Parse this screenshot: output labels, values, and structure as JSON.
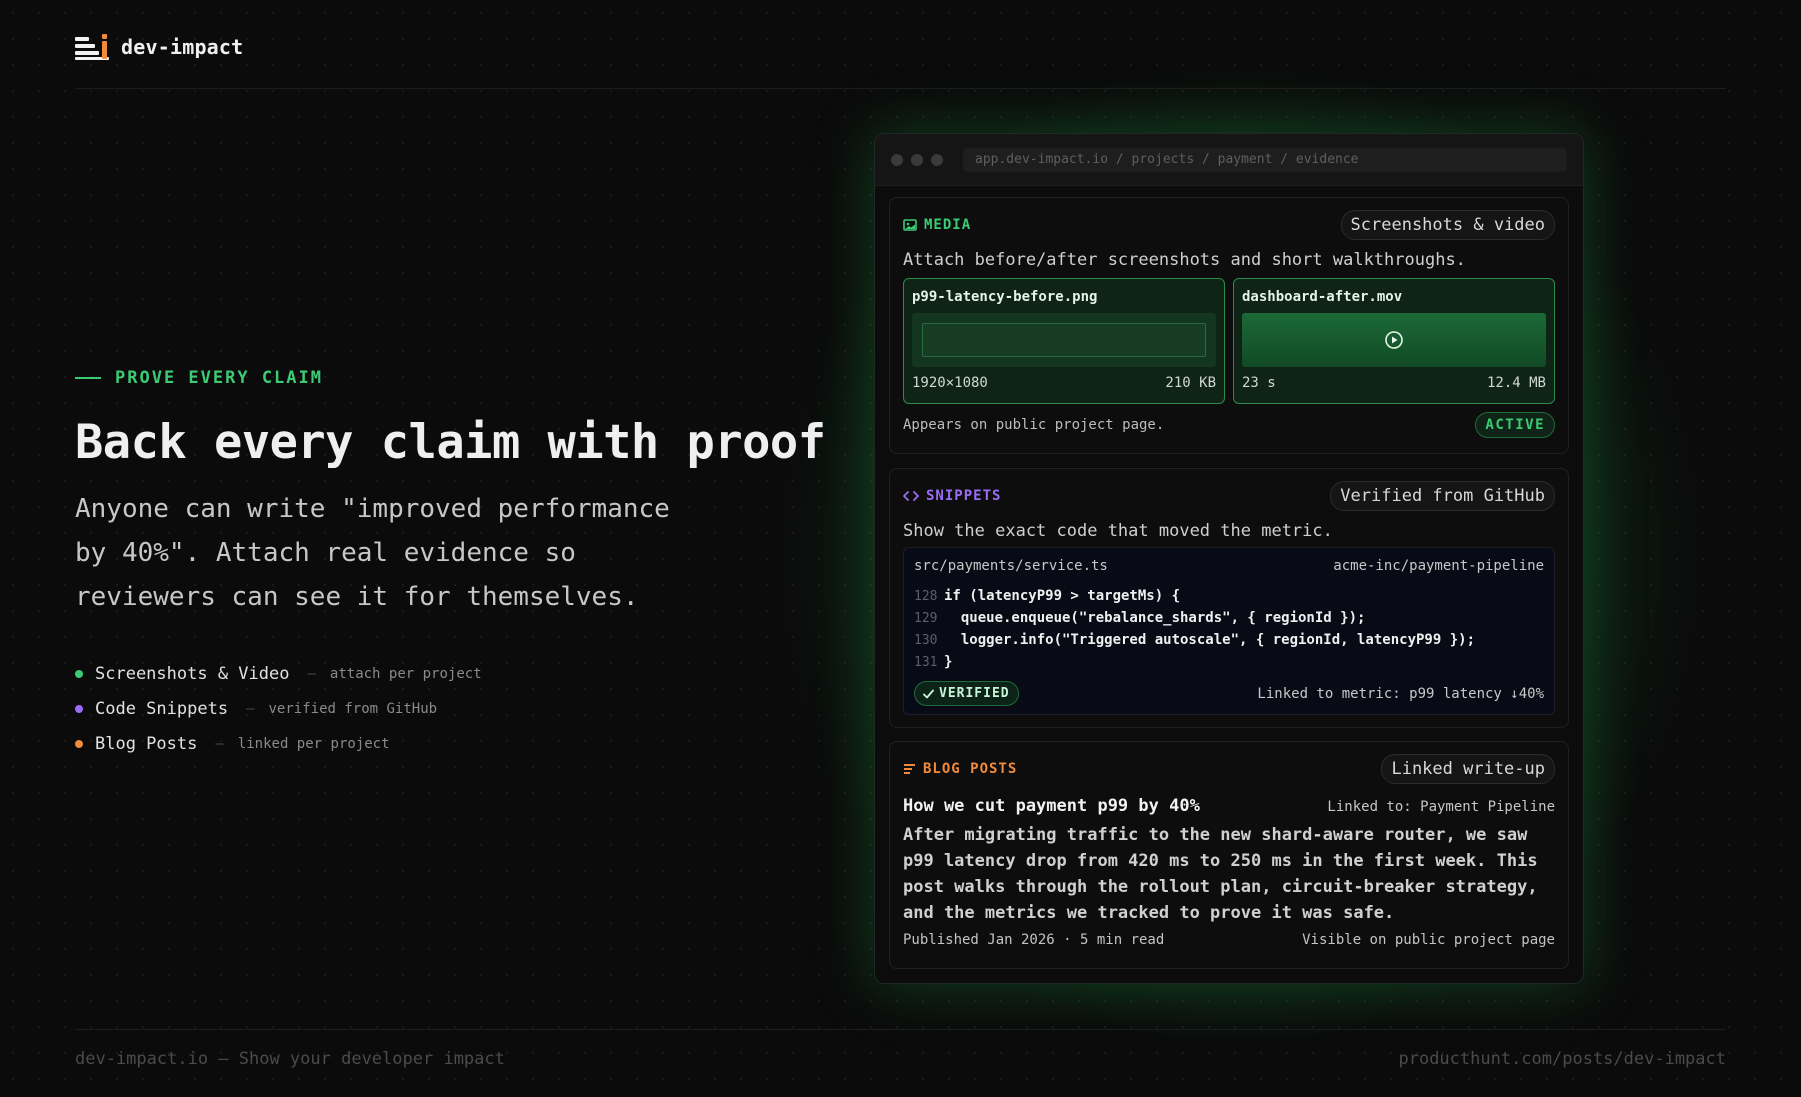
{
  "header": {
    "brand": "dev-impact",
    "logo_icon": "dev-impact-logo"
  },
  "hero": {
    "eyebrow": "PROVE EVERY CLAIM",
    "title": "Back every claim with proof",
    "subtitle": "Anyone can write \"improved performance by 40%\". Attach real evidence so reviewers can see it for themselves.",
    "features": [
      {
        "name": "Screenshots & Video",
        "desc": "attach per project",
        "color": "#3ccb74"
      },
      {
        "name": "Code Snippets",
        "desc": "verified from GitHub",
        "color": "#9b6cf5"
      },
      {
        "name": "Blog Posts",
        "desc": "linked per project",
        "color": "#f08a3c"
      }
    ],
    "separator": "—"
  },
  "window": {
    "url": "app.dev-impact.io / projects / payment / evidence",
    "media": {
      "tag": "MEDIA",
      "tag_color": "#3ccb74",
      "pill": "Screenshots & video",
      "text": "Attach before/after screenshots and short walkthroughs.",
      "tiles": [
        {
          "filename": "p99-latency-before.png",
          "dims": "1920×1080",
          "size": "210 KB",
          "kind": "image"
        },
        {
          "filename": "dashboard-after.mov",
          "dims": "23 s",
          "size": "12.4 MB",
          "kind": "video"
        }
      ],
      "note": "Appears on public project page.",
      "status": "ACTIVE"
    },
    "snippets": {
      "tag": "SNIPPETS",
      "tag_color": "#9b6cf5",
      "pill": "Verified from GitHub",
      "text": "Show the exact code that moved the metric.",
      "file": "src/payments/service.ts",
      "repo": "acme-inc/payment-pipeline",
      "lines": [
        {
          "n": "128",
          "code": "if (latencyP99 > targetMs) {"
        },
        {
          "n": "129",
          "code": "  queue.enqueue(\"rebalance_shards\", { regionId });"
        },
        {
          "n": "130",
          "code": "  logger.info(\"Triggered autoscale\", { regionId, latencyP99 });"
        },
        {
          "n": "131",
          "code": "}"
        }
      ],
      "verified": "VERIFIED",
      "metric": "Linked to metric: p99 latency ↓40%"
    },
    "blog": {
      "tag": "BLOG POSTS",
      "tag_color": "#f08a3c",
      "pill": "Linked write-up",
      "title": "How we cut payment p99 by 40%",
      "linked": "Linked to: Payment Pipeline",
      "body": "After migrating traffic to the new shard-aware router, we saw p99 latency drop from 420 ms to 250 ms in the first week. This post walks through the rollout plan, circuit-breaker strategy, and the metrics we tracked to prove it was safe.",
      "published": "Published Jan 2026 · 5 min read",
      "visibility": "Visible on public project page"
    }
  },
  "footer": {
    "left": "dev-impact.io — Show your developer impact",
    "right": "producthunt.com/posts/dev-impact"
  }
}
